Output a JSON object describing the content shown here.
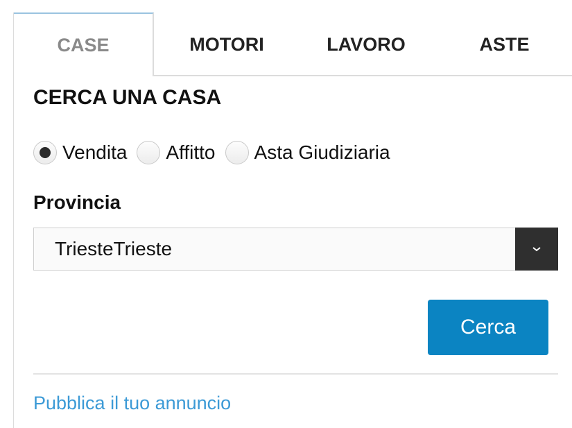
{
  "tabs": [
    {
      "label": "CASE",
      "active": true
    },
    {
      "label": "MOTORI",
      "active": false
    },
    {
      "label": "LAVORO",
      "active": false
    },
    {
      "label": "ASTE",
      "active": false
    }
  ],
  "form": {
    "title": "CERCA UNA CASA",
    "radios": [
      {
        "label": "Vendita",
        "checked": true
      },
      {
        "label": "Affitto",
        "checked": false
      },
      {
        "label": "Asta Giudiziaria",
        "checked": false
      }
    ],
    "provincia_label": "Provincia",
    "provincia_value": "TriesteTrieste",
    "search_button": "Cerca"
  },
  "footer": {
    "publish_link": "Pubblica il tuo annuncio"
  },
  "colors": {
    "button_bg": "#0b84c2",
    "link": "#3c9ad6",
    "active_tab_text": "#8a8a8a",
    "active_tab_top_border": "#9ac3e0",
    "select_arrow_bg": "#2f2f2f"
  },
  "icons": {
    "select_arrow": "chevron-down-icon"
  }
}
